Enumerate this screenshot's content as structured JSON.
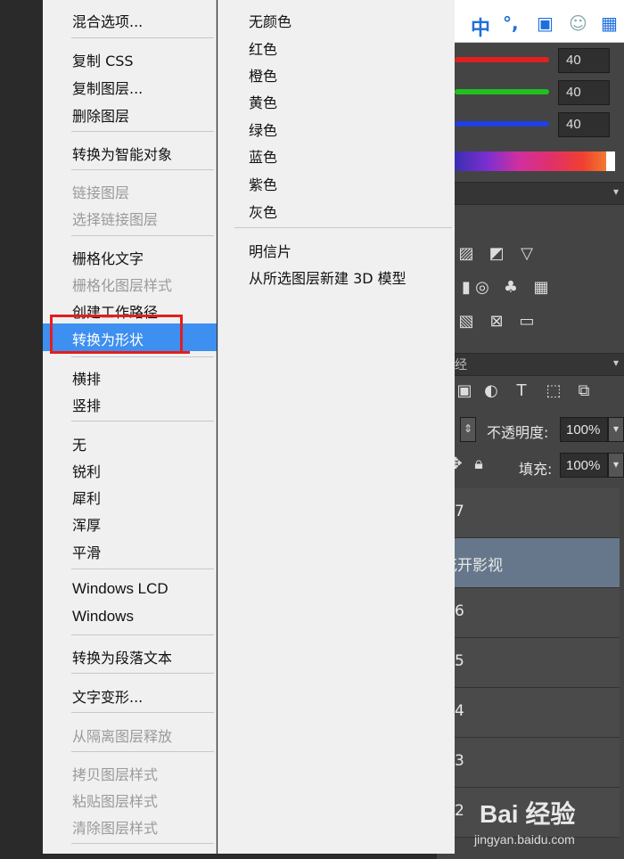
{
  "context_menu": {
    "items": [
      {
        "label": "混合选项...",
        "disabled": false
      },
      {
        "label": "复制 CSS",
        "disabled": false
      },
      {
        "label": "复制图层...",
        "disabled": false
      },
      {
        "label": "删除图层",
        "disabled": false
      },
      {
        "label": "转换为智能对象",
        "disabled": false
      },
      {
        "label": "链接图层",
        "disabled": true
      },
      {
        "label": "选择链接图层",
        "disabled": true
      },
      {
        "label": "栅格化文字",
        "disabled": false
      },
      {
        "label": "栅格化图层样式",
        "disabled": true
      },
      {
        "label": "创建工作路径",
        "disabled": false
      },
      {
        "label": "转换为形状",
        "disabled": false,
        "highlighted": true
      },
      {
        "label": "横排",
        "disabled": false
      },
      {
        "label": "竖排",
        "disabled": false
      },
      {
        "label": "无",
        "disabled": false
      },
      {
        "label": "锐利",
        "disabled": false
      },
      {
        "label": "犀利",
        "disabled": false
      },
      {
        "label": "浑厚",
        "disabled": false
      },
      {
        "label": "平滑",
        "disabled": false
      },
      {
        "label": "Windows LCD",
        "disabled": false
      },
      {
        "label": "Windows",
        "disabled": false
      },
      {
        "label": "转换为段落文本",
        "disabled": false
      },
      {
        "label": "文字变形...",
        "disabled": false
      },
      {
        "label": "从隔离图层释放",
        "disabled": true
      },
      {
        "label": "拷贝图层样式",
        "disabled": true
      },
      {
        "label": "粘贴图层样式",
        "disabled": true
      },
      {
        "label": "清除图层样式",
        "disabled": true
      }
    ]
  },
  "color_submenu": {
    "items": [
      "无颜色",
      "红色",
      "橙色",
      "黄色",
      "绿色",
      "蓝色",
      "紫色",
      "灰色",
      "明信片",
      "从所选图层新建 3D 模型"
    ]
  },
  "color_panel": {
    "values": [
      "40",
      "40",
      "40"
    ],
    "slider_colors": [
      "#e02020",
      "#20c020",
      "#2040e0"
    ]
  },
  "toolbar_ime": {
    "lang": "中",
    "punct": "°,"
  },
  "layers_panel": {
    "opacity_label": "不透明度:",
    "opacity_value": "100%",
    "fill_label": "填充:",
    "fill_value": "100%",
    "layers": [
      {
        "label": "7",
        "selected": false
      },
      {
        "label": "花开影视",
        "selected": true
      },
      {
        "label": "6",
        "selected": false
      },
      {
        "label": "5",
        "selected": false
      },
      {
        "label": "4",
        "selected": false
      },
      {
        "label": "3",
        "selected": false
      },
      {
        "label": "2",
        "selected": false
      }
    ]
  },
  "watermark": {
    "logo": "Bai 经验",
    "url": "jingyan.baidu.com"
  },
  "accent_colors": {
    "highlight": "#3d8ff0",
    "annotation_box": "#e51d1d"
  }
}
